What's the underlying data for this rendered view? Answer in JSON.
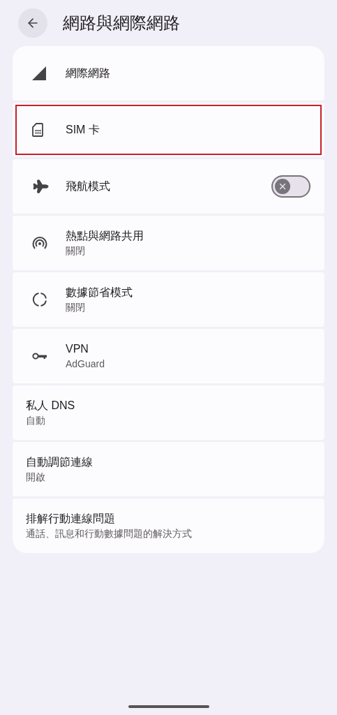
{
  "header": {
    "title": "網路與網際網路"
  },
  "items": [
    {
      "kind": "plain",
      "title": "網際網路",
      "highlighted": false
    },
    {
      "kind": "plain",
      "title": "SIM 卡",
      "highlighted": true
    },
    {
      "kind": "toggle",
      "title": "飛航模式",
      "on": false,
      "highlighted": false
    },
    {
      "kind": "plain",
      "title": "熱點與網路共用",
      "subtitle": "關閉",
      "highlighted": false
    },
    {
      "kind": "plain",
      "title": "數據節省模式",
      "subtitle": "關閉",
      "highlighted": false
    },
    {
      "kind": "plain",
      "title": "VPN",
      "subtitle": "AdGuard",
      "highlighted": false
    },
    {
      "kind": "plain",
      "title": "私人 DNS",
      "subtitle": "自動",
      "highlighted": false
    },
    {
      "kind": "plain",
      "title": "自動調節連線",
      "subtitle": "開啟",
      "highlighted": false
    },
    {
      "kind": "plain",
      "title": "排解行動連線問題",
      "subtitle": "通話、訊息和行動數據問題的解決方式",
      "highlighted": false
    }
  ]
}
